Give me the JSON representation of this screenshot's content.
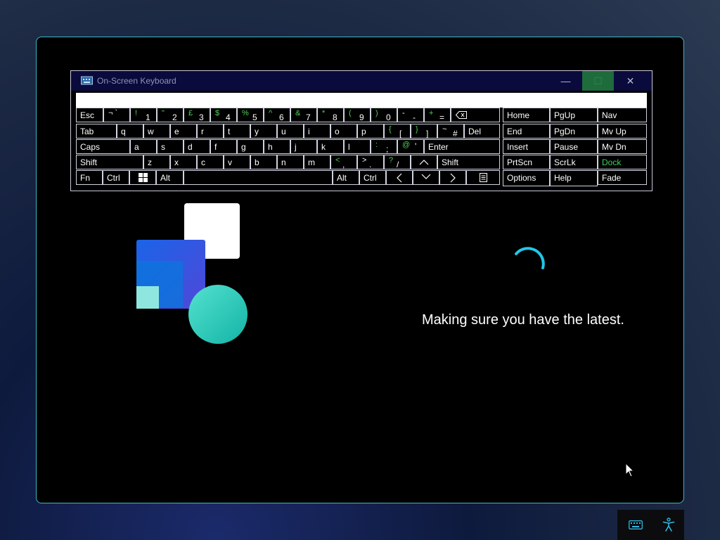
{
  "osk": {
    "title": "On-Screen Keyboard",
    "window_buttons": {
      "minimize": "—",
      "maximize": "☐",
      "close": "✕"
    },
    "input_value": ""
  },
  "keys": {
    "esc": "Esc",
    "k1": {
      "shift": "¬ `",
      "main": ""
    },
    "k2": {
      "shift": "!",
      "main": "1"
    },
    "k3": {
      "shift": "\"",
      "main": "2"
    },
    "k4": {
      "shift": "£",
      "main": "3"
    },
    "k5": {
      "shift": "$",
      "main": "4"
    },
    "k6": {
      "shift": "%",
      "main": "5"
    },
    "k7": {
      "shift": "^",
      "main": "6"
    },
    "k8": {
      "shift": "&",
      "main": "7"
    },
    "k9": {
      "shift": "*",
      "main": "8"
    },
    "k10": {
      "shift": "(",
      "main": "9"
    },
    "k11": {
      "shift": ")",
      "main": "0"
    },
    "k12": {
      "shift": "-",
      "main": "-"
    },
    "k13": {
      "shift": "+",
      "main": "="
    },
    "tab": "Tab",
    "q": "q",
    "w": "w",
    "e": "e",
    "r": "r",
    "t": "t",
    "y": "y",
    "u": "u",
    "i": "i",
    "o": "o",
    "p": "p",
    "lbrack": {
      "shift": "{",
      "main": "["
    },
    "rbrack": {
      "shift": "}",
      "main": "]"
    },
    "hash": {
      "shift": "~",
      "main": "#"
    },
    "del": "Del",
    "caps": "Caps",
    "a": "a",
    "s": "s",
    "d": "d",
    "f": "f",
    "g": "g",
    "h": "h",
    "j": "j",
    "k": "k",
    "l": "l",
    "semi": {
      "shift": ":",
      "main": ";"
    },
    "quote": {
      "shift": "@",
      "main": "'"
    },
    "enter": "Enter",
    "shift_l": "Shift",
    "z": "z",
    "x": "x",
    "c": "c",
    "v": "v",
    "b": "b",
    "n": "n",
    "m": "m",
    "comma": {
      "shift": "<",
      "main": ","
    },
    "period": {
      "shift": ">",
      "main": "."
    },
    "slash": {
      "shift": "?",
      "main": "/"
    },
    "shift_r": "Shift",
    "fn": "Fn",
    "ctrl_l": "Ctrl",
    "alt_l": "Alt",
    "alt_r": "Alt",
    "ctrl_r": "Ctrl",
    "home": "Home",
    "pgup": "PgUp",
    "nav": "Nav",
    "end": "End",
    "pgdn": "PgDn",
    "mvup": "Mv Up",
    "insert": "Insert",
    "pause": "Pause",
    "mvdn": "Mv Dn",
    "prtscn": "PrtScn",
    "scrlk": "ScrLk",
    "dock": "Dock",
    "options": "Options",
    "help": "Help",
    "fade": "Fade"
  },
  "status_text": "Making sure you have the latest.",
  "colors": {
    "accent_border": "#3fb6c4",
    "key_shift_green": "#4fd05a",
    "spinner": "#1fc8e6"
  },
  "tray": {
    "icons": [
      "keyboard-icon",
      "accessibility-icon"
    ]
  }
}
